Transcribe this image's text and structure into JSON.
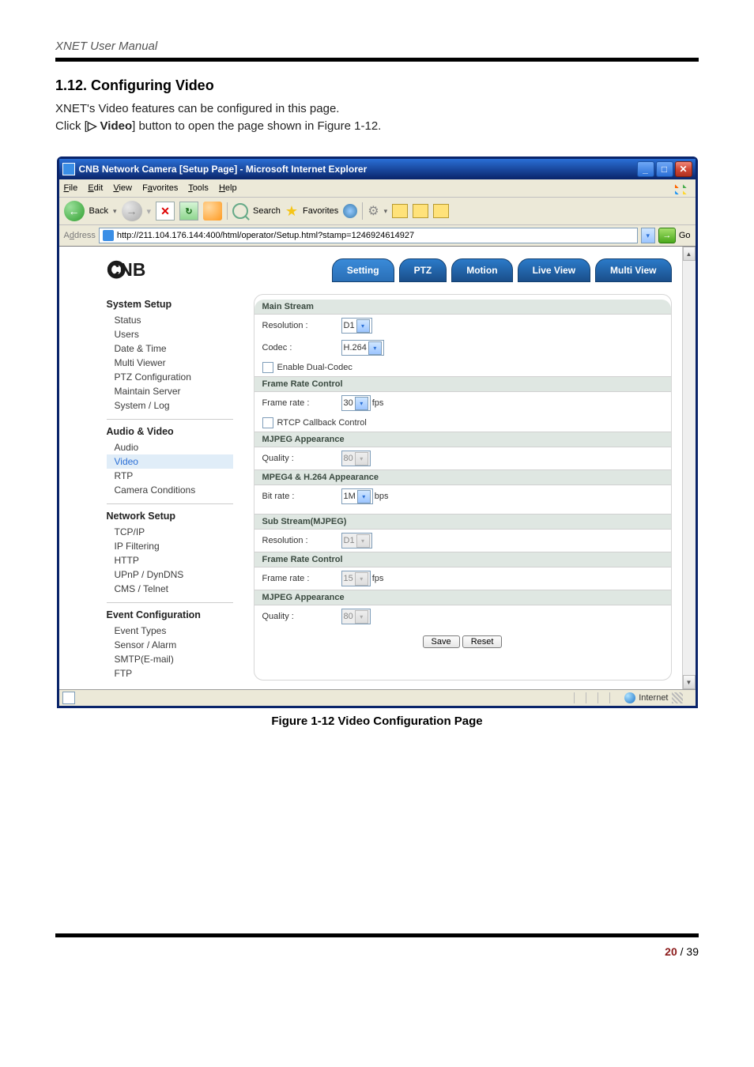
{
  "doc_header": "XNET User Manual",
  "section_heading": "1.12. Configuring Video",
  "intro_line1": "XNET's Video features can be configured in this page.",
  "intro_line2_pre": "Click [",
  "intro_line2_btn": "▷ Video",
  "intro_line2_post": "] button to open the page shown in Figure 1-12.",
  "figure_caption": "Figure 1-12 Video Configuration Page",
  "page_current": "20",
  "page_sep": " / ",
  "page_total": "39",
  "window": {
    "title": "CNB Network Camera [Setup Page] - Microsoft Internet Explorer",
    "menus": {
      "file": "File",
      "edit": "Edit",
      "view": "View",
      "favorites": "Favorites",
      "tools": "Tools",
      "help": "Help"
    },
    "toolbar": {
      "back": "Back",
      "search": "Search",
      "favorites": "Favorites"
    },
    "address_label": "Address",
    "address_url": "http://211.104.176.144:400/html/operator/Setup.html?stamp=1246924614927",
    "go": "Go",
    "statusbar": {
      "zone": "Internet"
    }
  },
  "nav": {
    "setting": "Setting",
    "ptz": "PTZ",
    "motion": "Motion",
    "liveview": "Live View",
    "multiview": "Multi View"
  },
  "sidebar": {
    "g1": {
      "title": "System Setup",
      "items": [
        "Status",
        "Users",
        "Date & Time",
        "Multi Viewer",
        "PTZ Configuration",
        "Maintain Server",
        "System / Log"
      ]
    },
    "g2": {
      "title": "Audio & Video",
      "items": [
        "Audio",
        "Video",
        "RTP",
        "Camera Conditions"
      ],
      "selected_index": 1
    },
    "g3": {
      "title": "Network Setup",
      "items": [
        "TCP/IP",
        "IP Filtering",
        "HTTP",
        "UPnP / DynDNS",
        "CMS / Telnet"
      ]
    },
    "g4": {
      "title": "Event Configuration",
      "items": [
        "Event Types",
        "Sensor / Alarm",
        "SMTP(E-mail)",
        "FTP"
      ]
    }
  },
  "form": {
    "main_stream": "Main Stream",
    "resolution_lbl": "Resolution :",
    "resolution_val": "D1",
    "codec_lbl": "Codec :",
    "codec_val": "H.264",
    "enable_dual": "Enable Dual-Codec",
    "frc": "Frame Rate Control",
    "framerate_lbl": "Frame rate :",
    "framerate_val": "30",
    "framerate_unit": "fps",
    "rtcp": "RTCP Callback Control",
    "mjpeg_app": "MJPEG Appearance",
    "quality_lbl": "Quality :",
    "quality_val": "80",
    "mpeg_app": "MPEG4 & H.264 Appearance",
    "bitrate_lbl": "Bit rate :",
    "bitrate_val": "1M",
    "bitrate_unit": "bps",
    "sub_stream": "Sub Stream(MJPEG)",
    "sub_res_val": "D1",
    "sub_fr_val": "15",
    "sub_fr_unit": "fps",
    "sub_quality_val": "80",
    "save": "Save",
    "reset": "Reset"
  }
}
